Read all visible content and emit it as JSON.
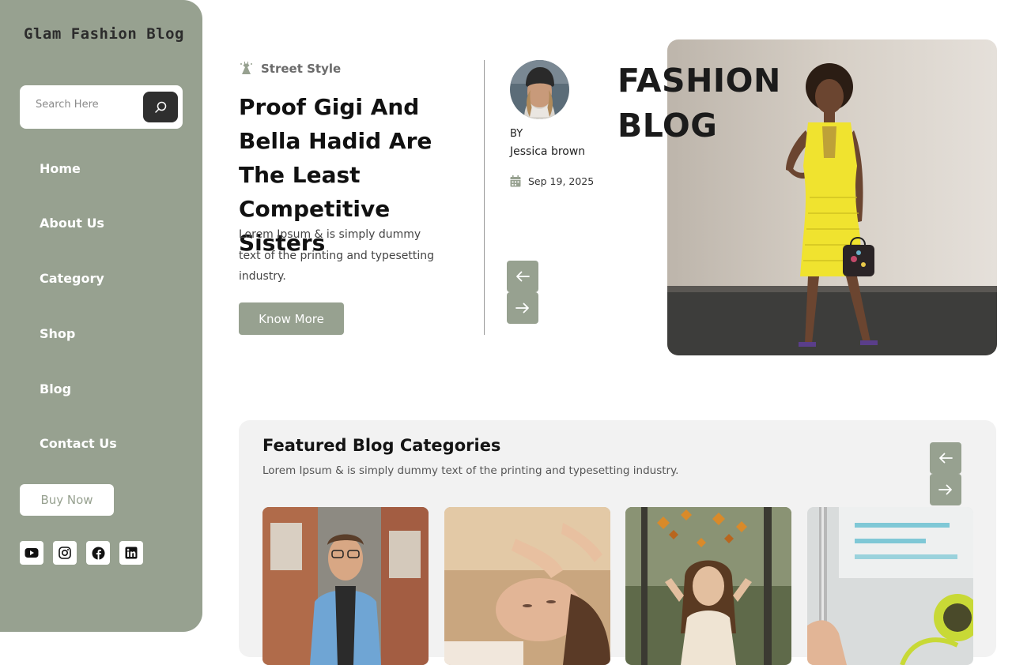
{
  "sidebar": {
    "logo": "Glam Fashion Blog",
    "search_placeholder": "Search Here",
    "nav": [
      "Home",
      "About Us",
      "Category",
      "Shop",
      "Blog",
      "Contact Us"
    ],
    "buy_label": "Buy Now",
    "socials": [
      "youtube-icon",
      "instagram-icon",
      "facebook-icon",
      "linkedin-icon"
    ]
  },
  "hero": {
    "tag": "Street Style",
    "title": "Proof Gigi And Bella Hadid Are The Least Competitive Sisters",
    "description": "Lorem Ipsum & is simply dummy text of the printing and typesetting industry.",
    "cta": "Know More",
    "by_label": "BY",
    "author": "Jessica brown",
    "date": "Sep 19, 2025",
    "big_title_line1": "FASHION",
    "big_title_line2": "BLOG"
  },
  "featured": {
    "title": "Featured Blog Categories",
    "description": "Lorem Ipsum & is simply dummy text of the printing and typesetting industry."
  },
  "colors": {
    "accent": "#97a190",
    "dark": "#2f2f2f",
    "panel": "#f2f2f2"
  }
}
